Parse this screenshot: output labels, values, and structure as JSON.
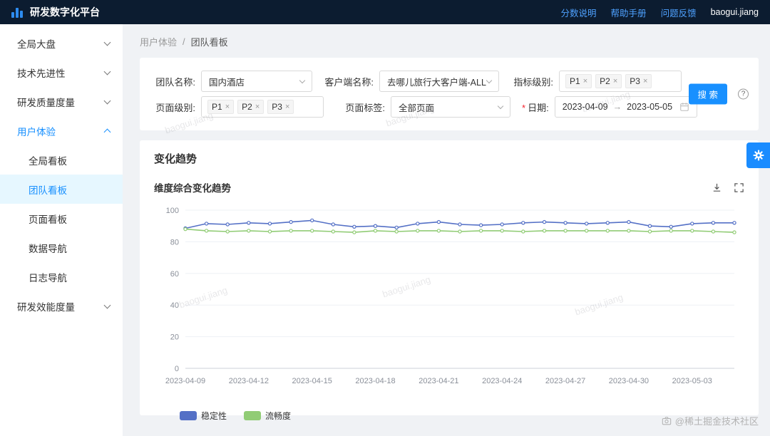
{
  "header": {
    "title": "研发数字化平台",
    "links": [
      "分数说明",
      "帮助手册",
      "问题反馈"
    ],
    "user": "baogui.jiang"
  },
  "sidebar": {
    "items": [
      {
        "label": "全局大盘"
      },
      {
        "label": "技术先进性"
      },
      {
        "label": "研发质量度量"
      },
      {
        "label": "用户体验",
        "expanded": true,
        "children": [
          "全局看板",
          "团队看板",
          "页面看板",
          "数据导航",
          "日志导航"
        ],
        "active_child": "团队看板"
      },
      {
        "label": "研发效能度量"
      }
    ]
  },
  "breadcrumb": {
    "parent": "用户体验",
    "current": "团队看板"
  },
  "filters": {
    "team_label": "团队名称:",
    "team_value": "国内酒店",
    "client_label": "客户端名称:",
    "client_value": "去哪儿旅行大客户端-ALL",
    "metric_label": "指标级别:",
    "metric_tags": [
      "P1",
      "P2",
      "P3"
    ],
    "page_level_label": "页面级别:",
    "page_level_tags": [
      "P1",
      "P2",
      "P3"
    ],
    "page_tag_label": "页面标签:",
    "page_tag_value": "全部页面",
    "date_label": "日期:",
    "date_start": "2023-04-09",
    "date_end": "2023-05-05",
    "search_button": "搜 索"
  },
  "panel": {
    "title": "变化趋势"
  },
  "chart_data": {
    "type": "line",
    "title": "维度综合变化趋势",
    "x": [
      "2023-04-09",
      "2023-04-10",
      "2023-04-11",
      "2023-04-12",
      "2023-04-13",
      "2023-04-14",
      "2023-04-15",
      "2023-04-16",
      "2023-04-17",
      "2023-04-18",
      "2023-04-19",
      "2023-04-20",
      "2023-04-21",
      "2023-04-22",
      "2023-04-23",
      "2023-04-24",
      "2023-04-25",
      "2023-04-26",
      "2023-04-27",
      "2023-04-28",
      "2023-04-29",
      "2023-04-30",
      "2023-05-01",
      "2023-05-02",
      "2023-05-03",
      "2023-05-04",
      "2023-05-05"
    ],
    "x_tick_labels": [
      "2023-04-09",
      "2023-04-12",
      "2023-04-15",
      "2023-04-18",
      "2023-04-21",
      "2023-04-24",
      "2023-04-27",
      "2023-04-30",
      "2023-05-03"
    ],
    "ylim": [
      0,
      100
    ],
    "y_ticks": [
      0,
      20,
      40,
      60,
      80,
      100
    ],
    "grid": true,
    "legend_position": "bottom-left",
    "series": [
      {
        "name": "稳定性",
        "color": "#5470c6",
        "values": [
          88.5,
          91.5,
          91,
          92,
          91.5,
          92.5,
          93.5,
          91,
          89.5,
          90,
          89,
          91.5,
          92.5,
          91,
          90.5,
          91,
          92,
          92.5,
          92,
          91.5,
          92,
          92.5,
          90,
          89.5,
          91.5,
          92,
          92
        ]
      },
      {
        "name": "流畅度",
        "color": "#91cc75",
        "values": [
          88,
          87,
          86.5,
          87,
          86.5,
          87,
          87,
          86.5,
          86,
          87,
          86.5,
          87,
          87,
          86.5,
          87,
          87,
          86.5,
          87,
          87,
          87,
          87,
          87,
          86.5,
          87,
          87,
          86.5,
          86
        ]
      }
    ]
  },
  "icons": {
    "close": "×",
    "arrow": "→",
    "question": "?",
    "slash": "/",
    "required": "*"
  },
  "watermark": {
    "text": "baogui.jiang"
  },
  "credit": "@稀土掘金技术社区"
}
